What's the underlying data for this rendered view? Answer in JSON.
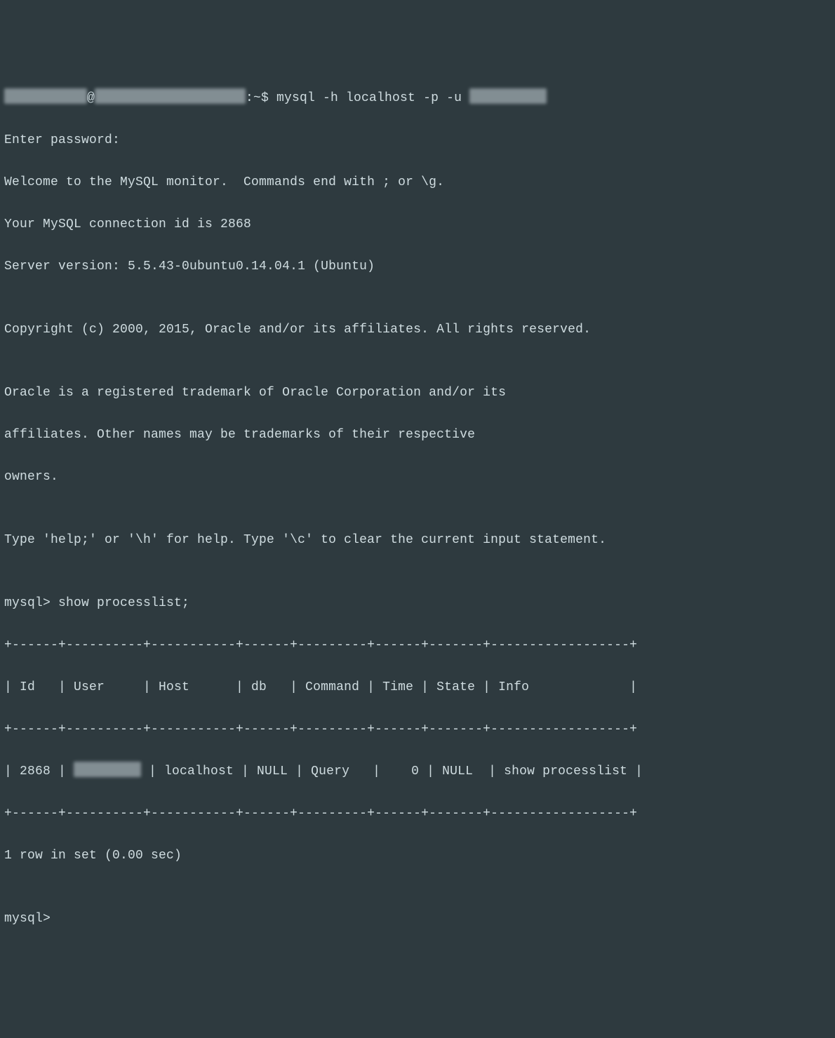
{
  "prompt": {
    "at": "@",
    "shell": ":~$ ",
    "cmd": "mysql -h localhost -p -u "
  },
  "banner": {
    "l1": "Enter password:",
    "l2": "Welcome to the MySQL monitor.  Commands end with ; or \\g.",
    "l3": "Your MySQL connection id is 2868",
    "l4": "Server version: 5.5.43-0ubuntu0.14.04.1 (Ubuntu)",
    "blank": "",
    "lcpy": "Copyright (c) 2000, 2015, Oracle and/or its affiliates. All rights reserved.",
    "ltr1": "Oracle is a registered trademark of Oracle Corporation and/or its",
    "ltr2": "affiliates. Other names may be trademarks of their respective",
    "ltr3": "owners.",
    "lhelp": "Type 'help;' or '\\h' for help. Type '\\c' to clear the current input statement."
  },
  "mysql": {
    "prompt1": "mysql> show processlist;",
    "sep": "+------+----------+-----------+------+---------+------+-------+------------------+",
    "hdr": "| Id   | User     | Host      | db   | Command | Time | State | Info             |",
    "row_pre": "| 2868 | ",
    "row_post": " | localhost | NULL | Query   |    0 | NULL  | show processlist |",
    "count": "1 row in set (0.00 sec)",
    "prompt2": "mysql>"
  }
}
